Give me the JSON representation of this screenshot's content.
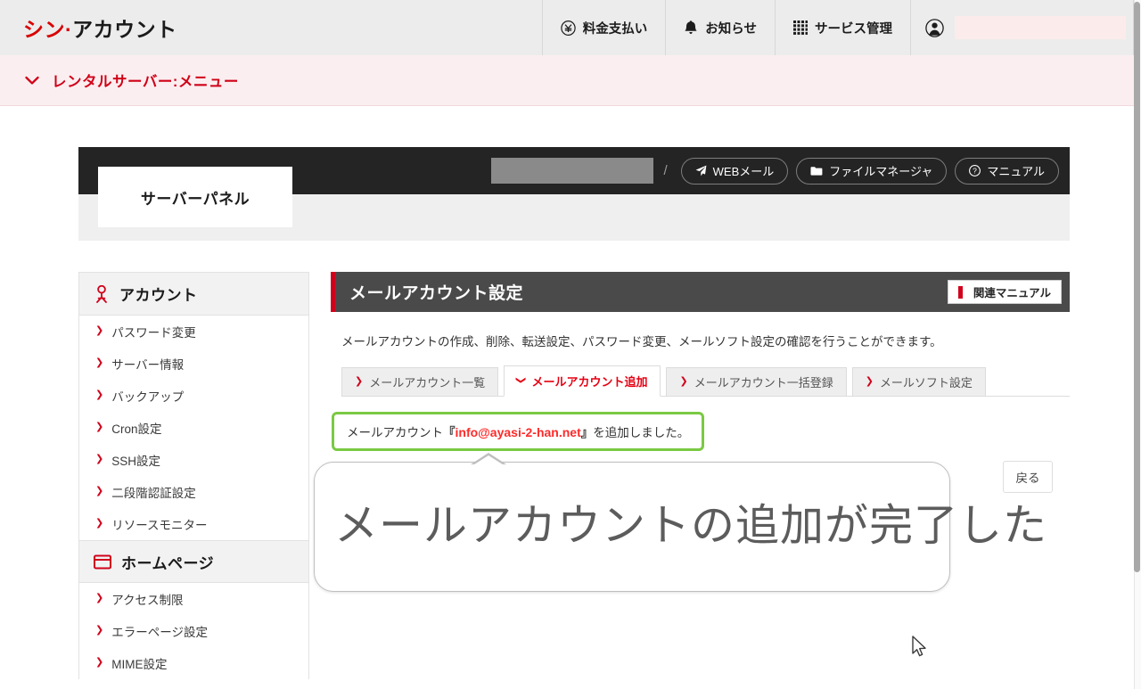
{
  "header": {
    "brand_part1": "シン·",
    "brand_part2": "アカウント",
    "items": [
      {
        "label": "料金支払い",
        "icon": "yen-circle-icon"
      },
      {
        "label": "お知らせ",
        "icon": "bell-icon"
      },
      {
        "label": "サービス管理",
        "icon": "grid-apps-icon"
      }
    ],
    "account_icon": "user-circle-icon",
    "account_value": ""
  },
  "menu_bar": {
    "label": "レンタルサーバー:メニュー",
    "icon": "chevron-down-icon"
  },
  "server_panel": {
    "badge": "サーバーパネル",
    "domain_value": "",
    "separator": "/",
    "buttons": [
      {
        "label": "WEBメール",
        "icon": "paper-plane-icon"
      },
      {
        "label": "ファイルマネージャ",
        "icon": "folder-icon"
      },
      {
        "label": "マニュアル",
        "icon": "question-circle-icon"
      }
    ]
  },
  "sidebar": {
    "sections": [
      {
        "title": "アカウント",
        "icon": "person-icon",
        "items": [
          {
            "label": "パスワード変更"
          },
          {
            "label": "サーバー情報"
          },
          {
            "label": "バックアップ"
          },
          {
            "label": "Cron設定"
          },
          {
            "label": "SSH設定"
          },
          {
            "label": "二段階認証設定"
          },
          {
            "label": "リソースモニター"
          }
        ]
      },
      {
        "title": "ホームページ",
        "icon": "browser-window-icon",
        "items": [
          {
            "label": "アクセス制限"
          },
          {
            "label": "エラーページ設定"
          },
          {
            "label": "MIME設定"
          }
        ]
      }
    ]
  },
  "main": {
    "title": "メールアカウント設定",
    "manual_button": "関連マニュアル",
    "manual_icon": "red-book-icon",
    "description": "メールアカウントの作成、削除、転送設定、パスワード変更、メールソフト設定の確認を行うことができます。",
    "tabs": [
      {
        "label": "メールアカウント一覧",
        "active": false,
        "icon": "chevron-right-icon"
      },
      {
        "label": "メールアカウント追加",
        "active": true,
        "icon": "chevron-down-icon"
      },
      {
        "label": "メールアカウント一括登録",
        "active": false,
        "icon": "chevron-right-icon"
      },
      {
        "label": "メールソフト設定",
        "active": false,
        "icon": "chevron-right-icon"
      }
    ],
    "success": {
      "prefix": "メールアカウント",
      "open_bracket": "『",
      "address": "info@ayasi-2-han.net",
      "close_bracket": "』",
      "suffix": "を追加しました。"
    },
    "back_button": "戻る"
  },
  "callout": {
    "text": "メールアカウントの追加が完了した"
  },
  "colors": {
    "brand_red": "#d80000",
    "accent_red": "#d0021b",
    "active_tab_red": "#e60012",
    "success_green": "#7ac943",
    "address_red": "#ff2a2a",
    "dark_bar": "#242424",
    "title_bar": "#4a4a4a",
    "menu_bg": "#fbeef0",
    "header_bg": "#ececec"
  }
}
